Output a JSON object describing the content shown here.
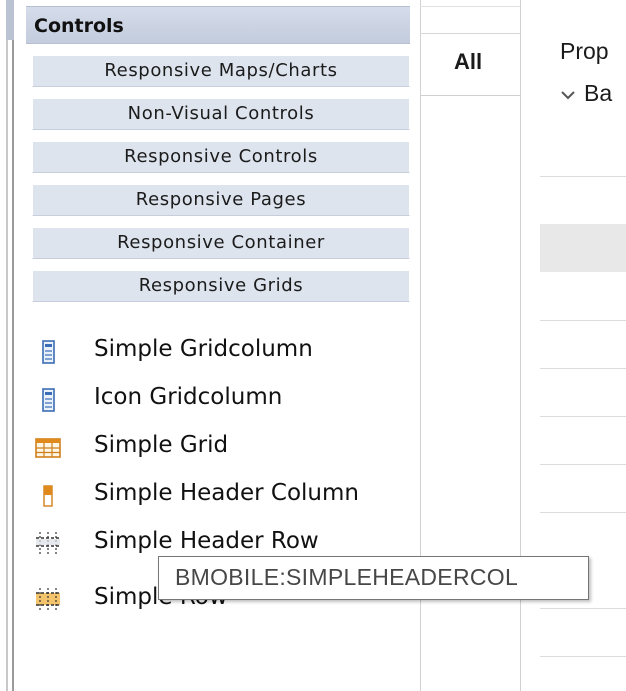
{
  "palette": {
    "header": "Controls",
    "drawers": [
      "Responsive Maps/Charts",
      "Non-Visual Controls",
      "Responsive Controls",
      "Responsive Pages",
      "Responsive Container",
      "Responsive Grids"
    ],
    "entries": [
      {
        "label": "Simple Gridcolumn",
        "icon": "gridcolumn-icon"
      },
      {
        "label": "Icon Gridcolumn",
        "icon": "gridcolumn-icon"
      },
      {
        "label": "Simple Grid",
        "icon": "grid-icon"
      },
      {
        "label": "Simple Header Column",
        "icon": "header-column-icon"
      },
      {
        "label": "Simple Header Row",
        "icon": "header-row-icon"
      },
      {
        "label": "Simple Row",
        "icon": "row-icon"
      }
    ]
  },
  "properties": {
    "tab_all": "All",
    "title": "Prop",
    "group": "Ba"
  },
  "tooltip": {
    "text": "BMOBILE:SIMPLEHEADERCOL"
  },
  "colors": {
    "header_bg": "#c9d1e0",
    "drawer_bg": "#dde4ee",
    "icon_blue": "#3a6db5",
    "icon_orange": "#e08a1e"
  }
}
